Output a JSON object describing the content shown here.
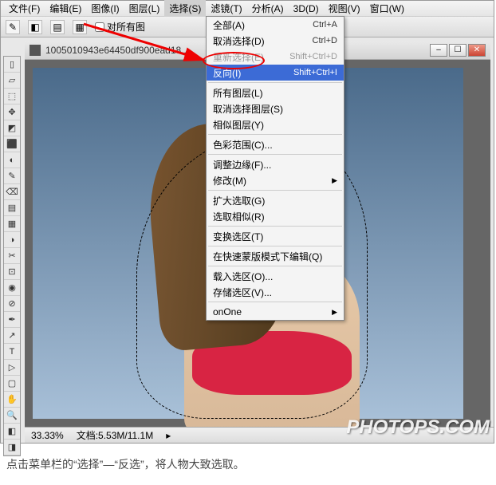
{
  "menubar": {
    "items": [
      {
        "label": "文件(F)"
      },
      {
        "label": "编辑(E)"
      },
      {
        "label": "图像(I)"
      },
      {
        "label": "图层(L)"
      },
      {
        "label": "选择(S)",
        "active": true
      },
      {
        "label": "滤镜(T)"
      },
      {
        "label": "分析(A)"
      },
      {
        "label": "3D(D)"
      },
      {
        "label": "视图(V)"
      },
      {
        "label": "窗口(W)"
      }
    ]
  },
  "toolbar": {
    "sample_label": "对所有图"
  },
  "document": {
    "title": "1005010943e64450df900ead18...",
    "zoom": "33.33%",
    "size_info": "文档:5.53M/11.1M"
  },
  "dropdown": {
    "items": [
      {
        "label": "全部(A)",
        "shortcut": "Ctrl+A"
      },
      {
        "label": "取消选择(D)",
        "shortcut": "Ctrl+D"
      },
      {
        "label": "重新选择(E)",
        "shortcut": "Shift+Ctrl+D",
        "disabled": true
      },
      {
        "label": "反向(I)",
        "shortcut": "Shift+Ctrl+I",
        "highlight": true
      },
      {
        "sep": true
      },
      {
        "label": "所有图层(L)"
      },
      {
        "label": "取消选择图层(S)"
      },
      {
        "label": "相似图层(Y)"
      },
      {
        "sep": true
      },
      {
        "label": "色彩范围(C)..."
      },
      {
        "sep": true
      },
      {
        "label": "调整边缘(F)..."
      },
      {
        "label": "修改(M)",
        "submenu": true
      },
      {
        "sep": true
      },
      {
        "label": "扩大选取(G)"
      },
      {
        "label": "选取相似(R)"
      },
      {
        "sep": true
      },
      {
        "label": "变换选区(T)"
      },
      {
        "sep": true
      },
      {
        "label": "在快速蒙版模式下编辑(Q)"
      },
      {
        "sep": true
      },
      {
        "label": "载入选区(O)..."
      },
      {
        "label": "存储选区(V)..."
      },
      {
        "sep": true
      },
      {
        "label": "onOne",
        "submenu": true
      }
    ]
  },
  "tools": [
    "▯",
    "▱",
    "⬚",
    "✥",
    "◩",
    "⬛",
    "◐",
    "✎",
    "⌫",
    "▤",
    "▦",
    "◑",
    "✂",
    "⊡",
    "◉",
    "⊘",
    "✒",
    "↗",
    "T",
    "▷",
    "▢",
    "✋",
    "🔍",
    "◧",
    "◨"
  ],
  "caption": "点击菜单栏的“选择”—“反选”，将人物大致选取。",
  "watermark": "PHOTOPS.COM"
}
